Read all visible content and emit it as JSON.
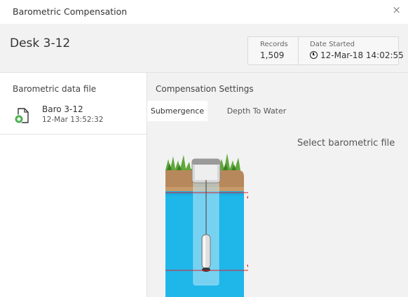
{
  "window": {
    "title": "Barometric Compensation",
    "close_glyph": "×"
  },
  "header": {
    "site_name": "Desk 3-12",
    "records_label": "Records",
    "records_value": "1,509",
    "date_started_label": "Date Started",
    "date_started_value": "12-Mar-18 14:02:55",
    "date_icon": "clock-icon"
  },
  "left_panel": {
    "heading": "Barometric data file",
    "files": [
      {
        "name": "Baro 3-12",
        "date": "12-Mar 13:52:32",
        "icon": "baro-file-icon"
      }
    ]
  },
  "right_panel": {
    "heading": "Compensation Settings",
    "tabs": [
      {
        "label": "Submergence",
        "active": true
      },
      {
        "label": "Depth To Water",
        "active": false
      }
    ],
    "message": "Select barometric file"
  },
  "colors": {
    "water": "#1fb6ea",
    "soil": "#c79a6a",
    "grass": "#5fa83a",
    "measure_line": "#e0202a",
    "file_icon_green": "#4caf50"
  }
}
